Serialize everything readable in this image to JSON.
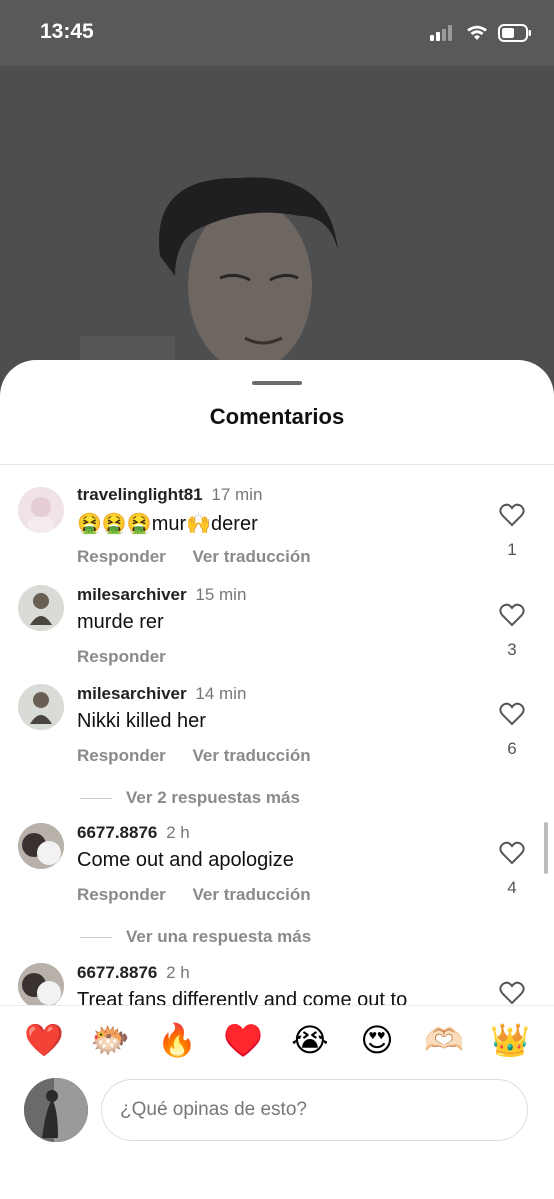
{
  "status_bar": {
    "time": "13:45"
  },
  "sheet": {
    "title": "Comentarios"
  },
  "comments": [
    {
      "username": "travelinglight81",
      "time": "17 min",
      "text": "🤮🤮🤮mur🙌derer",
      "reply": "Responder",
      "translate": "Ver traducción",
      "likes": "1"
    },
    {
      "username": "milesarchiver",
      "time": "15 min",
      "text": "murde rer",
      "reply": "Responder",
      "likes": "3"
    },
    {
      "username": "milesarchiver",
      "time": "14 min",
      "text": "Nikki killed her",
      "reply": "Responder",
      "translate": "Ver traducción",
      "likes": "6",
      "more_replies": "Ver 2 respuestas más"
    },
    {
      "username": "6677.8876",
      "time": "2 h",
      "text": "Come out and apologize",
      "reply": "Responder",
      "translate": "Ver traducción",
      "likes": "4",
      "more_replies": "Ver una respuesta más"
    },
    {
      "username": "6677.8876",
      "time": "2 h",
      "text": "Treat fans differently and come out to"
    }
  ],
  "reactions": [
    "❤️",
    "🐡",
    "🔥",
    "♥️",
    "😭",
    "😍",
    "🫶🏻",
    "👑"
  ],
  "input": {
    "placeholder": "¿Qué opinas de esto?"
  },
  "colors": {
    "sheet_bg": "#ffffff",
    "muted_text": "#8a8a8a",
    "overlay": "#58595b"
  }
}
